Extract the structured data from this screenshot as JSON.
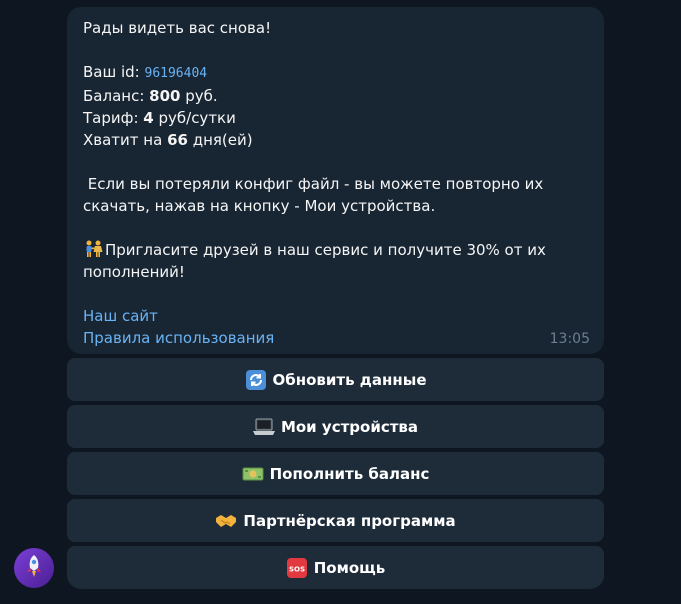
{
  "message": {
    "greeting": "Рады видеть вас снова!",
    "id_label": "Ваш id: ",
    "id_value": "96196404",
    "balance_label": "Баланс: ",
    "balance_value": "800",
    "balance_unit": " руб.",
    "tariff_label": "Тариф: ",
    "tariff_value": "4",
    "tariff_unit": " руб/сутки",
    "enough_label": "Хватит на ",
    "enough_value": "66",
    "enough_unit": " дня(ей)",
    "config_text_1": " Если вы потеряли конфиг файл - вы можете повторно их",
    "config_text_2": "скачать, нажав на кнопку - Мои устройства.",
    "invite_text_1": "Пригласите друзей в наш сервис и получите 30% от их",
    "invite_text_2": "пополнений!",
    "invite_icon": "people-holding-hands-icon",
    "link_site": "Наш сайт",
    "link_rules": "Правила использования",
    "time": "13:05"
  },
  "keyboard": {
    "refresh": {
      "label": "Обновить данные",
      "icon": "refresh-icon"
    },
    "devices": {
      "label": "Мои устройства",
      "icon": "laptop-icon"
    },
    "topup": {
      "label": "Пополнить баланс",
      "icon": "money-icon"
    },
    "partner": {
      "label": "Партнёрская программа",
      "icon": "handshake-icon"
    },
    "help": {
      "label": "Помощь",
      "icon": "sos-icon"
    }
  },
  "avatar": {
    "icon": "rocket-icon"
  },
  "colors": {
    "background": "#0e1621",
    "bubble": "#182533",
    "button": "#1e2c3a",
    "link": "#6ab3f3",
    "timestamp": "#6d7f8f"
  }
}
